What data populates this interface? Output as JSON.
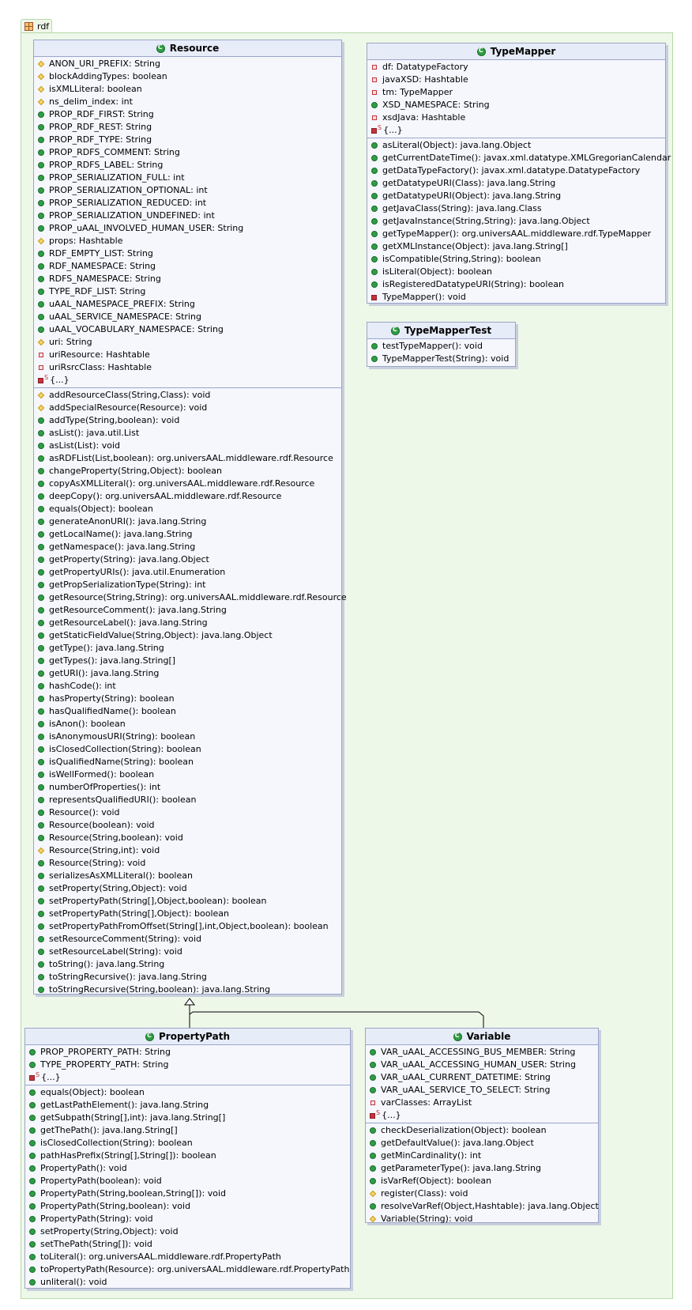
{
  "package": {
    "name": "rdf"
  },
  "classes": {
    "resource": {
      "name": "Resource",
      "fields": [
        {
          "vis": "protected",
          "text": "ANON_URI_PREFIX: String"
        },
        {
          "vis": "protected",
          "text": "blockAddingTypes: boolean"
        },
        {
          "vis": "protected",
          "text": "isXMLLiteral: boolean"
        },
        {
          "vis": "protected",
          "text": "ns_delim_index: int"
        },
        {
          "vis": "public",
          "text": "PROP_RDF_FIRST: String"
        },
        {
          "vis": "public",
          "text": "PROP_RDF_REST: String"
        },
        {
          "vis": "public",
          "text": "PROP_RDF_TYPE: String"
        },
        {
          "vis": "public",
          "text": "PROP_RDFS_COMMENT: String"
        },
        {
          "vis": "public",
          "text": "PROP_RDFS_LABEL: String"
        },
        {
          "vis": "public",
          "text": "PROP_SERIALIZATION_FULL: int"
        },
        {
          "vis": "public",
          "text": "PROP_SERIALIZATION_OPTIONAL: int"
        },
        {
          "vis": "public",
          "text": "PROP_SERIALIZATION_REDUCED: int"
        },
        {
          "vis": "public",
          "text": "PROP_SERIALIZATION_UNDEFINED: int"
        },
        {
          "vis": "public",
          "text": "PROP_uAAL_INVOLVED_HUMAN_USER: String"
        },
        {
          "vis": "protected",
          "text": "props: Hashtable"
        },
        {
          "vis": "public",
          "text": "RDF_EMPTY_LIST: String"
        },
        {
          "vis": "public",
          "text": "RDF_NAMESPACE: String"
        },
        {
          "vis": "public",
          "text": "RDFS_NAMESPACE: String"
        },
        {
          "vis": "public",
          "text": "TYPE_RDF_LIST: String"
        },
        {
          "vis": "public",
          "text": "uAAL_NAMESPACE_PREFIX: String"
        },
        {
          "vis": "public",
          "text": "uAAL_SERVICE_NAMESPACE: String"
        },
        {
          "vis": "public",
          "text": "uAAL_VOCABULARY_NAMESPACE: String"
        },
        {
          "vis": "protected",
          "text": "uri: String"
        },
        {
          "vis": "private",
          "text": "uriResource: Hashtable"
        },
        {
          "vis": "private",
          "text": "uriRsrcClass: Hashtable"
        },
        {
          "vis": "static-block",
          "text": "{...}"
        }
      ],
      "methods": [
        {
          "vis": "protected",
          "text": "addResourceClass(String,Class): void"
        },
        {
          "vis": "protected",
          "text": "addSpecialResource(Resource): void"
        },
        {
          "vis": "public",
          "text": "addType(String,boolean): void"
        },
        {
          "vis": "public",
          "text": "asList(): java.util.List"
        },
        {
          "vis": "public",
          "text": "asList(List): void"
        },
        {
          "vis": "public",
          "text": "asRDFList(List,boolean): org.universAAL.middleware.rdf.Resource"
        },
        {
          "vis": "public",
          "text": "changeProperty(String,Object): boolean"
        },
        {
          "vis": "public",
          "text": "copyAsXMLLiteral(): org.universAAL.middleware.rdf.Resource"
        },
        {
          "vis": "public",
          "text": "deepCopy(): org.universAAL.middleware.rdf.Resource"
        },
        {
          "vis": "public",
          "text": "equals(Object): boolean"
        },
        {
          "vis": "public",
          "text": "generateAnonURI(): java.lang.String"
        },
        {
          "vis": "public",
          "text": "getLocalName(): java.lang.String"
        },
        {
          "vis": "public",
          "text": "getNamespace(): java.lang.String"
        },
        {
          "vis": "public",
          "text": "getProperty(String): java.lang.Object"
        },
        {
          "vis": "public",
          "text": "getPropertyURIs(): java.util.Enumeration"
        },
        {
          "vis": "public",
          "text": "getPropSerializationType(String): int"
        },
        {
          "vis": "public",
          "text": "getResource(String,String): org.universAAL.middleware.rdf.Resource"
        },
        {
          "vis": "public",
          "text": "getResourceComment(): java.lang.String"
        },
        {
          "vis": "public",
          "text": "getResourceLabel(): java.lang.String"
        },
        {
          "vis": "public",
          "text": "getStaticFieldValue(String,Object): java.lang.Object"
        },
        {
          "vis": "public",
          "text": "getType(): java.lang.String"
        },
        {
          "vis": "public",
          "text": "getTypes(): java.lang.String[]"
        },
        {
          "vis": "public",
          "text": "getURI(): java.lang.String"
        },
        {
          "vis": "public",
          "text": "hashCode(): int"
        },
        {
          "vis": "public",
          "text": "hasProperty(String): boolean"
        },
        {
          "vis": "public",
          "text": "hasQualifiedName(): boolean"
        },
        {
          "vis": "public",
          "text": "isAnon(): boolean"
        },
        {
          "vis": "public",
          "text": "isAnonymousURI(String): boolean"
        },
        {
          "vis": "public",
          "text": "isClosedCollection(String): boolean"
        },
        {
          "vis": "public",
          "text": "isQualifiedName(String): boolean"
        },
        {
          "vis": "public",
          "text": "isWellFormed(): boolean"
        },
        {
          "vis": "public",
          "text": "numberOfProperties(): int"
        },
        {
          "vis": "public",
          "text": "representsQualifiedURI(): boolean"
        },
        {
          "vis": "public",
          "text": "Resource(): void"
        },
        {
          "vis": "public",
          "text": "Resource(boolean): void"
        },
        {
          "vis": "public",
          "text": "Resource(String,boolean): void"
        },
        {
          "vis": "protected",
          "text": "Resource(String,int): void"
        },
        {
          "vis": "public",
          "text": "Resource(String): void"
        },
        {
          "vis": "public",
          "text": "serializesAsXMLLiteral(): boolean"
        },
        {
          "vis": "public",
          "text": "setProperty(String,Object): void"
        },
        {
          "vis": "public",
          "text": "setPropertyPath(String[],Object,boolean): boolean"
        },
        {
          "vis": "public",
          "text": "setPropertyPath(String[],Object): boolean"
        },
        {
          "vis": "public",
          "text": "setPropertyPathFromOffset(String[],int,Object,boolean): boolean"
        },
        {
          "vis": "public",
          "text": "setResourceComment(String): void"
        },
        {
          "vis": "public",
          "text": "setResourceLabel(String): void"
        },
        {
          "vis": "public",
          "text": "toString(): java.lang.String"
        },
        {
          "vis": "public",
          "text": "toStringRecursive(): java.lang.String"
        },
        {
          "vis": "public",
          "text": "toStringRecursive(String,boolean): java.lang.String"
        }
      ]
    },
    "typemapper": {
      "name": "TypeMapper",
      "fields": [
        {
          "vis": "private",
          "text": "df: DatatypeFactory"
        },
        {
          "vis": "private",
          "text": "javaXSD: Hashtable"
        },
        {
          "vis": "private",
          "text": "tm: TypeMapper"
        },
        {
          "vis": "public",
          "text": "XSD_NAMESPACE: String"
        },
        {
          "vis": "private",
          "text": "xsdJava: Hashtable"
        },
        {
          "vis": "static-block",
          "text": "{...}"
        }
      ],
      "methods": [
        {
          "vis": "public",
          "text": "asLiteral(Object): java.lang.Object"
        },
        {
          "vis": "public",
          "text": "getCurrentDateTime(): javax.xml.datatype.XMLGregorianCalendar"
        },
        {
          "vis": "public",
          "text": "getDataTypeFactory(): javax.xml.datatype.DatatypeFactory"
        },
        {
          "vis": "public",
          "text": "getDatatypeURI(Class): java.lang.String"
        },
        {
          "vis": "public",
          "text": "getDatatypeURI(Object): java.lang.String"
        },
        {
          "vis": "public",
          "text": "getJavaClass(String): java.lang.Class"
        },
        {
          "vis": "public",
          "text": "getJavaInstance(String,String): java.lang.Object"
        },
        {
          "vis": "public",
          "text": "getTypeMapper(): org.universAAL.middleware.rdf.TypeMapper"
        },
        {
          "vis": "public",
          "text": "getXMLInstance(Object): java.lang.String[]"
        },
        {
          "vis": "public",
          "text": "isCompatible(String,String): boolean"
        },
        {
          "vis": "public",
          "text": "isLiteral(Object): boolean"
        },
        {
          "vis": "public",
          "text": "isRegisteredDatatypeURI(String): boolean"
        },
        {
          "vis": "private-block",
          "text": "TypeMapper(): void"
        }
      ]
    },
    "typemappertest": {
      "name": "TypeMapperTest",
      "methods": [
        {
          "vis": "public",
          "text": "testTypeMapper(): void"
        },
        {
          "vis": "public",
          "text": "TypeMapperTest(String): void"
        }
      ]
    },
    "propertypath": {
      "name": "PropertyPath",
      "fields": [
        {
          "vis": "public",
          "text": "PROP_PROPERTY_PATH: String"
        },
        {
          "vis": "public",
          "text": "TYPE_PROPERTY_PATH: String"
        },
        {
          "vis": "static-block",
          "text": "{...}"
        }
      ],
      "methods": [
        {
          "vis": "public",
          "text": "equals(Object): boolean"
        },
        {
          "vis": "public",
          "text": "getLastPathElement(): java.lang.String"
        },
        {
          "vis": "public",
          "text": "getSubpath(String[],int): java.lang.String[]"
        },
        {
          "vis": "public",
          "text": "getThePath(): java.lang.String[]"
        },
        {
          "vis": "public",
          "text": "isClosedCollection(String): boolean"
        },
        {
          "vis": "public",
          "text": "pathHasPrefix(String[],String[]): boolean"
        },
        {
          "vis": "public",
          "text": "PropertyPath(): void"
        },
        {
          "vis": "public",
          "text": "PropertyPath(boolean): void"
        },
        {
          "vis": "public",
          "text": "PropertyPath(String,boolean,String[]): void"
        },
        {
          "vis": "public",
          "text": "PropertyPath(String,boolean): void"
        },
        {
          "vis": "public",
          "text": "PropertyPath(String): void"
        },
        {
          "vis": "public",
          "text": "setProperty(String,Object): void"
        },
        {
          "vis": "public",
          "text": "setThePath(String[]): void"
        },
        {
          "vis": "public",
          "text": "toLiteral(): org.universAAL.middleware.rdf.PropertyPath"
        },
        {
          "vis": "public",
          "text": "toPropertyPath(Resource): org.universAAL.middleware.rdf.PropertyPath"
        },
        {
          "vis": "public",
          "text": "unliteral(): void"
        }
      ]
    },
    "variable": {
      "name": "Variable",
      "fields": [
        {
          "vis": "public",
          "text": "VAR_uAAL_ACCESSING_BUS_MEMBER: String"
        },
        {
          "vis": "public",
          "text": "VAR_uAAL_ACCESSING_HUMAN_USER: String"
        },
        {
          "vis": "public",
          "text": "VAR_uAAL_CURRENT_DATETIME: String"
        },
        {
          "vis": "public",
          "text": "VAR_uAAL_SERVICE_TO_SELECT: String"
        },
        {
          "vis": "private",
          "text": "varClasses: ArrayList"
        },
        {
          "vis": "static-block",
          "text": "{...}"
        }
      ],
      "methods": [
        {
          "vis": "public",
          "text": "checkDeserialization(Object): boolean"
        },
        {
          "vis": "public",
          "text": "getDefaultValue(): java.lang.Object"
        },
        {
          "vis": "public",
          "text": "getMinCardinality(): int"
        },
        {
          "vis": "public",
          "text": "getParameterType(): java.lang.String"
        },
        {
          "vis": "public",
          "text": "isVarRef(Object): boolean"
        },
        {
          "vis": "protected",
          "text": "register(Class): void"
        },
        {
          "vis": "public",
          "text": "resolveVarRef(Object,Hashtable): java.lang.Object"
        },
        {
          "vis": "protected",
          "text": "Variable(String): void"
        }
      ]
    }
  }
}
